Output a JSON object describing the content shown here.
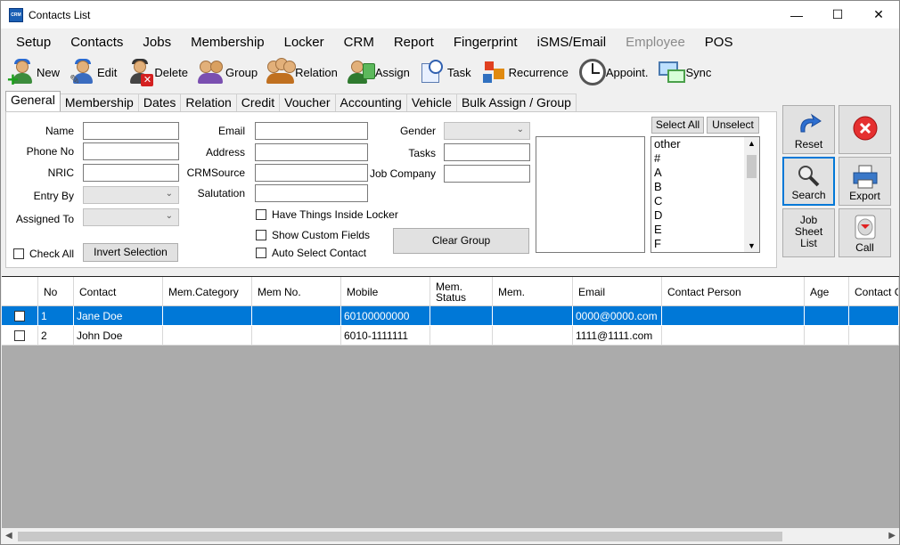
{
  "window": {
    "title": "Contacts List",
    "icon_text": "CRM",
    "minimize": "—",
    "maximize": "☐",
    "close": "✕"
  },
  "menu": [
    "Setup",
    "Contacts",
    "Jobs",
    "Membership",
    "Locker",
    "CRM",
    "Report",
    "Fingerprint",
    "iSMS/Email",
    "Employee",
    "POS"
  ],
  "menu_disabled": "Employee",
  "toolbar": {
    "new": "New",
    "edit": "Edit",
    "delete": "Delete",
    "group": "Group",
    "relation": "Relation",
    "assign": "Assign",
    "task": "Task",
    "recurrence": "Recurrence",
    "appoint": "Appoint.",
    "sync": "Sync"
  },
  "tabs": [
    "General",
    "Membership",
    "Dates",
    "Relation",
    "Credit",
    "Voucher",
    "Accounting",
    "Vehicle",
    "Bulk Assign / Group"
  ],
  "form": {
    "name": "Name",
    "phone": "Phone No",
    "nric": "NRIC",
    "entry_by": "Entry By",
    "assigned_to": "Assigned To",
    "email": "Email",
    "address": "Address",
    "crmsource": "CRMSource",
    "salutation": "Salutation",
    "gender": "Gender",
    "tasks": "Tasks",
    "job_company": "Job Company",
    "have_things": "Have Things Inside Locker",
    "show_custom": "Show Custom Fields",
    "auto_select": "Auto Select Contact",
    "check_all": "Check All",
    "invert_selection": "Invert Selection",
    "clear_group": "Clear Group",
    "select_all": "Select All",
    "unselect": "Unselect"
  },
  "alpha_list": [
    "other",
    "#",
    "A",
    "B",
    "C",
    "D",
    "E",
    "F"
  ],
  "side": {
    "reset": "Reset",
    "search": "Search",
    "export": "Export",
    "job_sheet": "Job Sheet List",
    "call": "Call"
  },
  "grid": {
    "columns": [
      "No",
      "Contact",
      "Mem.Category",
      "Mem No.",
      "Mobile",
      "Mem. Status",
      "Mem.",
      "Email",
      "Contact Person",
      "Age",
      "Contact G"
    ],
    "rows": [
      {
        "no": "1",
        "contact": "Jane Doe",
        "mobile": "60100000000",
        "email": "0000@0000.com",
        "selected": true
      },
      {
        "no": "2",
        "contact": "John Doe",
        "mobile": "6010-1111111",
        "email": "1111@1111.com",
        "selected": false
      }
    ]
  },
  "colors": {
    "selection": "#0078d7",
    "grid_bg": "#ababab",
    "accent": "#0078d7"
  }
}
